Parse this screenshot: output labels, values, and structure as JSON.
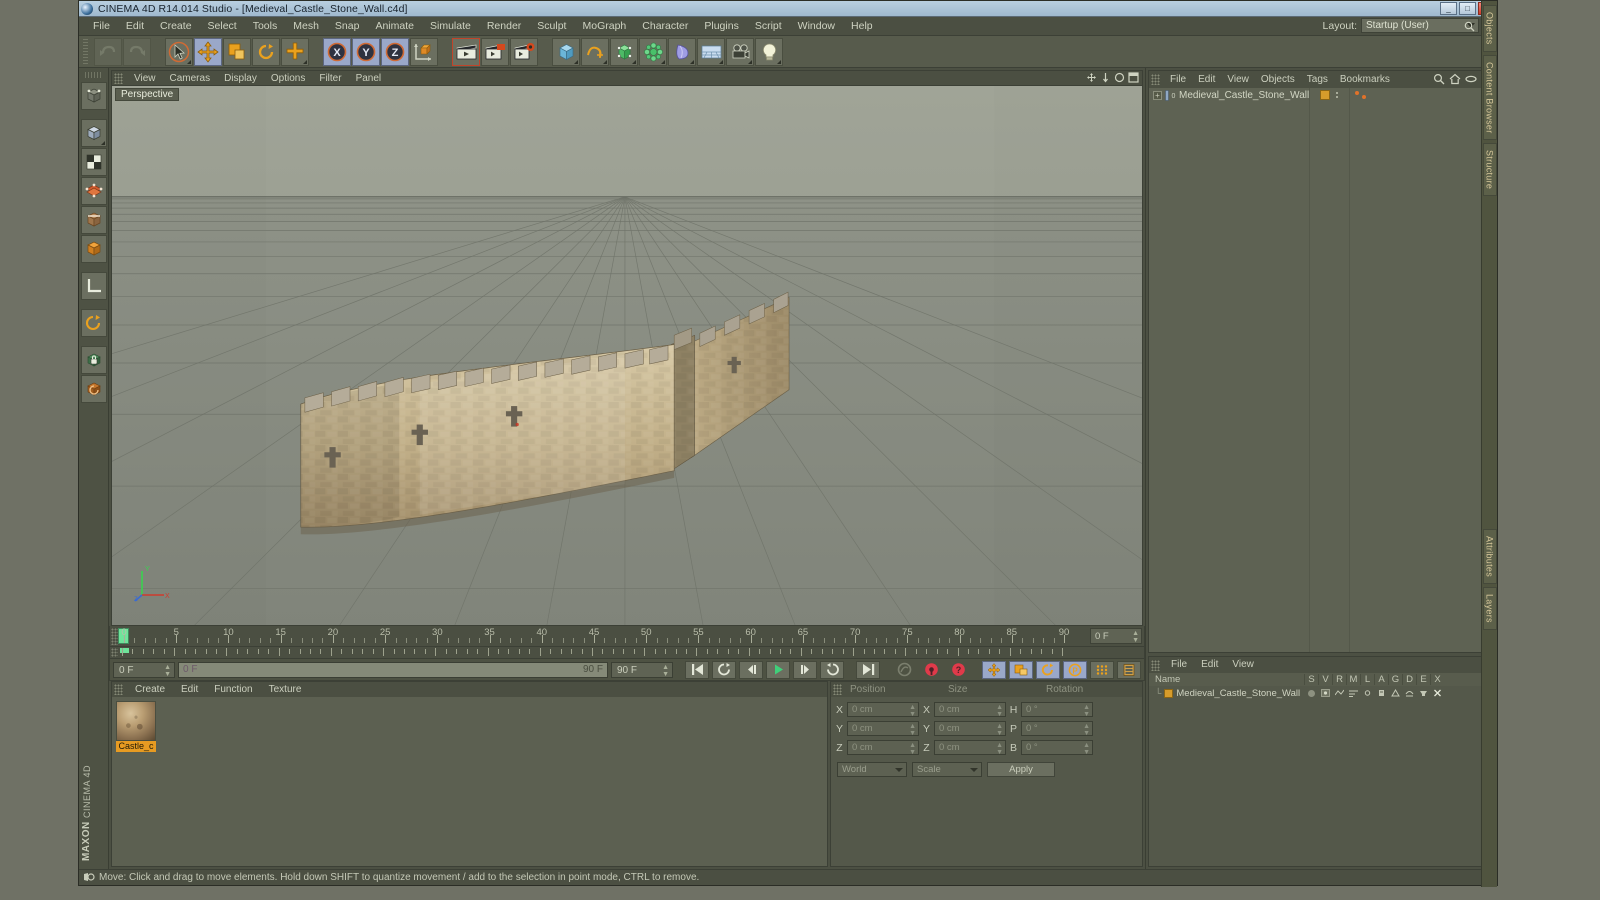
{
  "window": {
    "title": "CINEMA 4D R14.014 Studio - [Medieval_Castle_Stone_Wall.c4d]",
    "minimize": "_",
    "maximize": "□",
    "close": "×"
  },
  "menubar": {
    "items": [
      "File",
      "Edit",
      "Create",
      "Select",
      "Tools",
      "Mesh",
      "Snap",
      "Animate",
      "Simulate",
      "Render",
      "Sculpt",
      "MoGraph",
      "Character",
      "Plugins",
      "Script",
      "Window",
      "Help"
    ],
    "layout_label": "Layout:",
    "layout_value": "Startup (User)"
  },
  "toolbar": {
    "groups": [
      {
        "name": "history",
        "buttons": [
          {
            "name": "undo-button",
            "icon": "undo",
            "state": "disabled"
          },
          {
            "name": "redo-button",
            "icon": "redo",
            "state": "disabled"
          }
        ]
      },
      {
        "name": "tools",
        "buttons": [
          {
            "name": "live-selection-button",
            "icon": "cursor-circle",
            "state": "hot"
          },
          {
            "name": "move-tool-button",
            "icon": "move",
            "state": "selected"
          },
          {
            "name": "scale-tool-button",
            "icon": "scale",
            "state": "normal"
          },
          {
            "name": "rotate-tool-button",
            "icon": "rotate",
            "state": "normal"
          },
          {
            "name": "add-tool-button",
            "icon": "plus",
            "state": "normal"
          }
        ]
      },
      {
        "name": "axis-locks",
        "buttons": [
          {
            "name": "lock-x-axis-button",
            "icon": "x-axis",
            "state": "selected"
          },
          {
            "name": "lock-y-axis-button",
            "icon": "y-axis",
            "state": "selected"
          },
          {
            "name": "lock-z-axis-button",
            "icon": "z-axis",
            "state": "selected"
          },
          {
            "name": "world-object-coordinates-button",
            "icon": "world-axis",
            "state": "normal"
          }
        ]
      },
      {
        "name": "render",
        "buttons": [
          {
            "name": "render-view-button",
            "icon": "clapper",
            "state": "hot"
          },
          {
            "name": "render-region-button",
            "icon": "clapper-region",
            "state": "normal"
          },
          {
            "name": "render-settings-button",
            "icon": "clapper-gear",
            "state": "normal"
          }
        ]
      },
      {
        "name": "create",
        "buttons": [
          {
            "name": "cube-primitive-button",
            "icon": "cube",
            "state": "normal"
          },
          {
            "name": "spline-button",
            "icon": "spline",
            "state": "normal"
          },
          {
            "name": "nurbs-button",
            "icon": "nurbs",
            "state": "normal"
          },
          {
            "name": "array-button",
            "icon": "array",
            "state": "normal"
          },
          {
            "name": "deformer-button",
            "icon": "deformer",
            "state": "normal"
          },
          {
            "name": "floor-environment-button",
            "icon": "floor",
            "state": "normal"
          },
          {
            "name": "camera-button",
            "icon": "camera",
            "state": "normal"
          },
          {
            "name": "light-button",
            "icon": "light",
            "state": "normal"
          }
        ]
      }
    ]
  },
  "left_toolbar": {
    "buttons": [
      {
        "name": "make-editable-button",
        "icon": "make-editable"
      },
      {
        "name": "model-mode-button",
        "icon": "cube-mode"
      },
      {
        "name": "texture-mode-button",
        "icon": "checker"
      },
      {
        "name": "points-mode-button",
        "icon": "points"
      },
      {
        "name": "edges-mode-button",
        "icon": "edges"
      },
      {
        "name": "polygons-mode-button",
        "icon": "polygons"
      },
      {
        "name": "object-axis-mode-button",
        "icon": "axis-mode"
      },
      {
        "name": "enable-axis-button",
        "icon": "axis-arc"
      },
      {
        "name": "viewport-solo-button",
        "icon": "solo-lock"
      },
      {
        "name": "workplane-button",
        "icon": "workplane"
      }
    ],
    "brand_top": "MAXON",
    "brand_bottom": "CINEMA 4D"
  },
  "viewport": {
    "menu": [
      "View",
      "Cameras",
      "Display",
      "Options",
      "Filter",
      "Panel"
    ],
    "label": "Perspective",
    "axis": {
      "x": "X",
      "y": "Y",
      "z": "Z"
    }
  },
  "timeline": {
    "ticks": [
      0,
      5,
      10,
      15,
      20,
      25,
      30,
      35,
      40,
      45,
      50,
      55,
      60,
      65,
      70,
      75,
      80,
      85,
      90
    ],
    "current_frame_field": "0 F"
  },
  "transport": {
    "current_frame": "0 F",
    "range_start": "0 F",
    "range_end": "90 F",
    "end_frame": "90 F",
    "controls": [
      {
        "name": "go-to-start-button",
        "icon": "skip-start"
      },
      {
        "name": "play-backwards-loop-button",
        "icon": "loop-back"
      },
      {
        "name": "step-back-button",
        "icon": "step-back"
      },
      {
        "name": "play-button",
        "icon": "play"
      },
      {
        "name": "step-forward-button",
        "icon": "step-forward"
      },
      {
        "name": "loop-button",
        "icon": "loop"
      },
      {
        "name": "go-to-end-button",
        "icon": "skip-end"
      }
    ],
    "record_controls": [
      {
        "name": "record-active-objects-button",
        "icon": "key-record",
        "state": "disabled"
      },
      {
        "name": "autokeying-button",
        "icon": "autokey",
        "state": "red"
      },
      {
        "name": "keyframe-selection-button",
        "icon": "question",
        "state": "red"
      }
    ],
    "key_toggles": [
      {
        "name": "position-key-button",
        "icon": "move-key",
        "state": "selected"
      },
      {
        "name": "scale-key-button",
        "icon": "scale-key",
        "state": "selected"
      },
      {
        "name": "rotation-key-button",
        "icon": "rotate-key",
        "state": "selected"
      },
      {
        "name": "parameter-key-button",
        "icon": "param-key",
        "state": "selected"
      },
      {
        "name": "point-level-animation-button",
        "icon": "pla-key",
        "state": "normal"
      },
      {
        "name": "timeline-layout-button",
        "icon": "layout-key",
        "state": "normal"
      }
    ]
  },
  "material_manager": {
    "menu": [
      "Create",
      "Edit",
      "Function",
      "Texture"
    ],
    "materials": [
      {
        "name": "Castle_c",
        "label": "Castle_c"
      }
    ]
  },
  "coordinate_manager": {
    "headers": [
      "Position",
      "Size",
      "Rotation"
    ],
    "rows": [
      {
        "axis1": "X",
        "value1": "0 cm",
        "axis2": "X",
        "value2": "0 cm",
        "axis3": "H",
        "value3": "0 °"
      },
      {
        "axis1": "Y",
        "value1": "0 cm",
        "axis2": "Y",
        "value2": "0 cm",
        "axis3": "P",
        "value3": "0 °"
      },
      {
        "axis1": "Z",
        "value1": "0 cm",
        "axis2": "Z",
        "value2": "0 cm",
        "axis3": "B",
        "value3": "0 °"
      }
    ],
    "coord_system": "World",
    "size_mode": "Scale",
    "apply_label": "Apply"
  },
  "object_manager": {
    "menu": [
      "File",
      "Edit",
      "View",
      "Objects",
      "Tags",
      "Bookmarks"
    ],
    "objects": [
      {
        "name": "Medieval_Castle_Stone_Wall",
        "level": 0,
        "visible": true
      }
    ],
    "icons": [
      "search-icon",
      "home-icon",
      "ellipse-icon",
      "layer-icon"
    ]
  },
  "attribute_manager": {
    "menu": [
      "File",
      "Edit",
      "View"
    ],
    "columns": [
      "Name",
      "S",
      "V",
      "R",
      "M",
      "L",
      "A",
      "G",
      "D",
      "E",
      "X"
    ],
    "rows": [
      {
        "name": "Medieval_Castle_Stone_Wall"
      }
    ]
  },
  "dock_tabs": [
    "Objects",
    "Content Browser",
    "Structure",
    "Attributes",
    "Layers"
  ],
  "statusbar": {
    "message": "Move: Click and drag to move elements. Hold down SHIFT to quantize movement / add to the selection in point mode, CTRL to remove."
  },
  "colors": {
    "accent_orange": "#e08a26",
    "selected_blue": "#9aa8c9",
    "panel_bg": "#4c5043",
    "menu_bg": "#4b4f42",
    "viewport_bg": "#8e9287",
    "play_green": "#3fd07a",
    "record_red": "#e03a4a"
  }
}
